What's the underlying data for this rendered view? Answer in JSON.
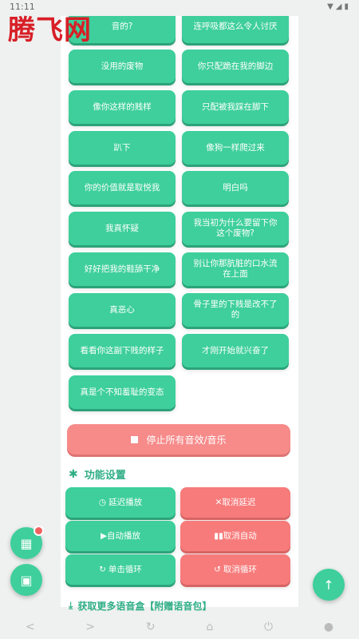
{
  "status": {
    "time": "11:11",
    "system_icons": "▼◢▮"
  },
  "logo": {
    "text": "腾飞网"
  },
  "sound_buttons": [
    {
      "label": "音的?",
      "col": "left"
    },
    {
      "label": "连呼吸都这么令人讨厌",
      "col": "right"
    },
    {
      "label": "没用的废物",
      "col": "left"
    },
    {
      "label": "你只配跪在我的脚边",
      "col": "right"
    },
    {
      "label": "像你这样的贱样",
      "col": "left"
    },
    {
      "label": "只配被我踩在脚下",
      "col": "right"
    },
    {
      "label": "趴下",
      "col": "left"
    },
    {
      "label": "像狗一样爬过来",
      "col": "right"
    },
    {
      "label": "你的价值就是取悦我",
      "col": "left"
    },
    {
      "label": "明白吗",
      "col": "right"
    },
    {
      "label": "我真怀疑",
      "col": "left"
    },
    {
      "label": "我当初为什么要留下你这个废物?",
      "col": "right"
    },
    {
      "label": "好好把我的鞋舔干净",
      "col": "left"
    },
    {
      "label": "别让你那肮脏的口水流在上面",
      "col": "right"
    },
    {
      "label": "真恶心",
      "col": "left"
    },
    {
      "label": "骨子里的下贱是改不了的",
      "col": "right"
    },
    {
      "label": "看看你这副下贱的样子",
      "col": "left"
    },
    {
      "label": "才刚开始就兴奋了",
      "col": "right"
    },
    {
      "label": "真是个不知羞耻的变态",
      "col": "left"
    }
  ],
  "stop_all": {
    "label": "停止所有音效/音乐"
  },
  "settings": {
    "title": "功能设置",
    "delay_play": "延迟播放",
    "cancel_delay": "✕取消延迟",
    "auto_play": "▶自动播放",
    "cancel_auto": "▮▮取消自动",
    "single_loop": "单击循环",
    "cancel_loop": "取消循环"
  },
  "more": {
    "label": "获取更多语音盒【附赠语音包】"
  },
  "nav": {
    "back": "<",
    "forward": ">",
    "refresh": "↻",
    "home": "⌂",
    "power": "⏻",
    "circle": "●"
  }
}
